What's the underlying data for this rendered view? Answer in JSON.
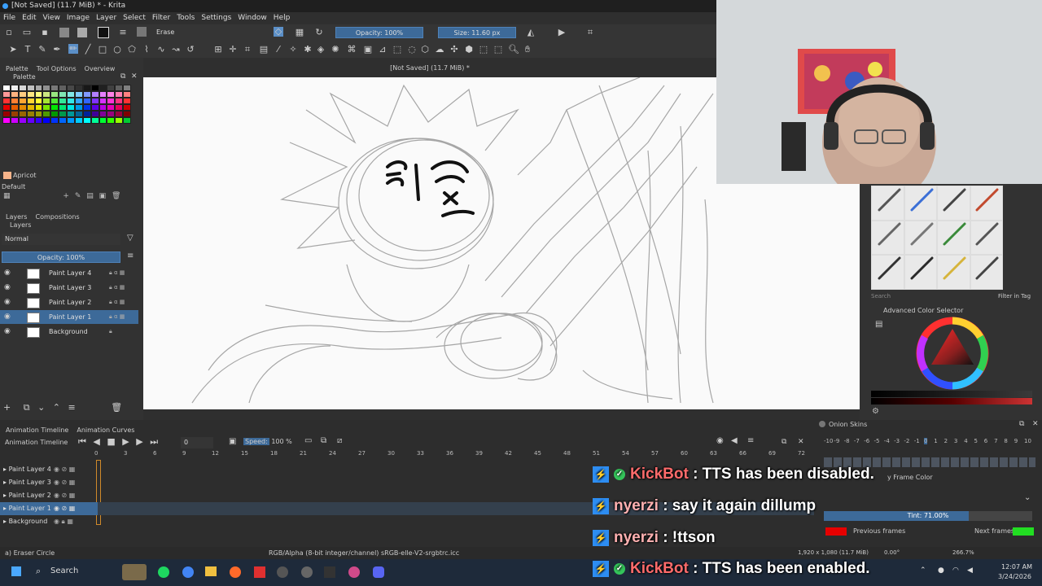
{
  "window": {
    "title": "[Not Saved]  (11.7 MiB) * - Krita"
  },
  "menu": [
    "File",
    "Edit",
    "View",
    "Image",
    "Layer",
    "Select",
    "Filter",
    "Tools",
    "Settings",
    "Window",
    "Help"
  ],
  "toolbar": {
    "brush_preset": "Erase",
    "opacity": "Opacity: 100%",
    "size": "Size: 11.60 px"
  },
  "docker_tabs_top": [
    "Palette",
    "Tool Options",
    "Overview"
  ],
  "palette": {
    "title": "Palette",
    "selected_color_name": "Apricot",
    "palette_name": "Default",
    "colors": [
      "#ffffff",
      "#f0f0f0",
      "#d8d8d8",
      "#c0c0c0",
      "#a8a8a8",
      "#909090",
      "#787878",
      "#606060",
      "#484848",
      "#303030",
      "#181818",
      "#000000",
      "#202020",
      "#404040",
      "#606060",
      "#808080",
      "#ff9999",
      "#ffb380",
      "#ffcc80",
      "#ffe680",
      "#ffff80",
      "#cce680",
      "#99e680",
      "#80e6b3",
      "#80e6e6",
      "#80ccff",
      "#8099ff",
      "#b380ff",
      "#e680ff",
      "#ff80e6",
      "#ff80b3",
      "#ff8080",
      "#ff3333",
      "#ff8033",
      "#ffa633",
      "#ffd633",
      "#ffff33",
      "#a6e633",
      "#4de633",
      "#33e699",
      "#33e6e6",
      "#33a6ff",
      "#3366ff",
      "#8033ff",
      "#d633ff",
      "#ff33d6",
      "#ff3380",
      "#ff3333",
      "#e60000",
      "#e65c00",
      "#e68a00",
      "#e6b800",
      "#e6e600",
      "#7ae600",
      "#00e600",
      "#00e673",
      "#00e6e6",
      "#0099e6",
      "#0033e6",
      "#5c00e6",
      "#b800e6",
      "#e600b8",
      "#e6005c",
      "#cc0000",
      "#990000",
      "#994000",
      "#996600",
      "#998000",
      "#999900",
      "#4d9900",
      "#009900",
      "#00994d",
      "#009999",
      "#006699",
      "#002299",
      "#400099",
      "#800099",
      "#990080",
      "#990040",
      "#800000",
      "#ff00ff",
      "#cc00ff",
      "#9900ff",
      "#6600ff",
      "#3300ff",
      "#0000ff",
      "#0033ff",
      "#0066ff",
      "#0099ff",
      "#00ccff",
      "#00ffff",
      "#00ff99",
      "#00ff33",
      "#33ff00",
      "#99ff00",
      "#00cc33"
    ]
  },
  "layers_panel": {
    "tabs": [
      "Layers",
      "Compositions"
    ],
    "blend_mode": "Normal",
    "opacity": "Opacity:  100%",
    "layers": [
      {
        "name": "Paint Layer 4",
        "selected": false
      },
      {
        "name": "Paint Layer 3",
        "selected": false
      },
      {
        "name": "Paint Layer 2",
        "selected": false
      },
      {
        "name": "Paint Layer 1",
        "selected": true
      },
      {
        "name": "Background",
        "selected": false
      }
    ]
  },
  "canvas_title": "[Not Saved]  (11.7 MiB) *",
  "brush_search": "Search",
  "filter_in_tag": "Filter in Tag",
  "color_selector": {
    "title": "Advanced Color Selector"
  },
  "animation": {
    "tabs": [
      "Animation Timeline",
      "Animation Curves"
    ],
    "title": "Animation Timeline",
    "frame": "0",
    "speed_label": "Speed:",
    "speed_value": "100 %",
    "ruler": [
      "0",
      "3",
      "6",
      "9",
      "12",
      "15",
      "18",
      "21",
      "24",
      "27",
      "30",
      "33",
      "36",
      "39",
      "42",
      "45",
      "48",
      "51",
      "54",
      "57",
      "60",
      "63",
      "66",
      "69",
      "72"
    ],
    "layers": [
      {
        "name": "Paint Layer 4",
        "selected": false
      },
      {
        "name": "Paint Layer 3",
        "selected": false
      },
      {
        "name": "Paint Layer 2",
        "selected": false
      },
      {
        "name": "Paint Layer 1",
        "selected": true
      },
      {
        "name": "Background",
        "selected": false
      }
    ]
  },
  "onion_skins": {
    "title": "Onion Skins",
    "ruler": [
      "-10",
      "-9",
      "-8",
      "-7",
      "-6",
      "-5",
      "-4",
      "-3",
      "-2",
      "-1",
      "0",
      "1",
      "2",
      "3",
      "4",
      "5",
      "6",
      "7",
      "8",
      "9",
      "10"
    ],
    "by_frame_color": "y Frame Color",
    "tint": "Tint: 71.00%",
    "previous_frames": "Previous frames",
    "next_frames": "Next frames",
    "previous_color": "#e60000",
    "next_color": "#22dd22"
  },
  "status": {
    "tool": "a) Eraser Circle",
    "color_space": "RGB/Alpha (8-bit integer/channel)  sRGB-elle-V2-srgbtrc.icc",
    "dimensions": "1,920 x 1,080 (11.7 MiB)",
    "rotation": "0.00°",
    "zoom": "266.7%"
  },
  "chat": [
    {
      "user": "KickBot",
      "verified": true,
      "message": ": TTS has been disabled."
    },
    {
      "user": "nyerzi",
      "verified": false,
      "message": ": say it again dillump"
    },
    {
      "user": "nyerzi",
      "verified": false,
      "message": ": !ttson"
    },
    {
      "user": "KickBot",
      "verified": true,
      "message": ": TTS has been enabled."
    }
  ],
  "taskbar": {
    "search": "Search",
    "time": "12:07 AM",
    "date": "3/24/2026"
  }
}
